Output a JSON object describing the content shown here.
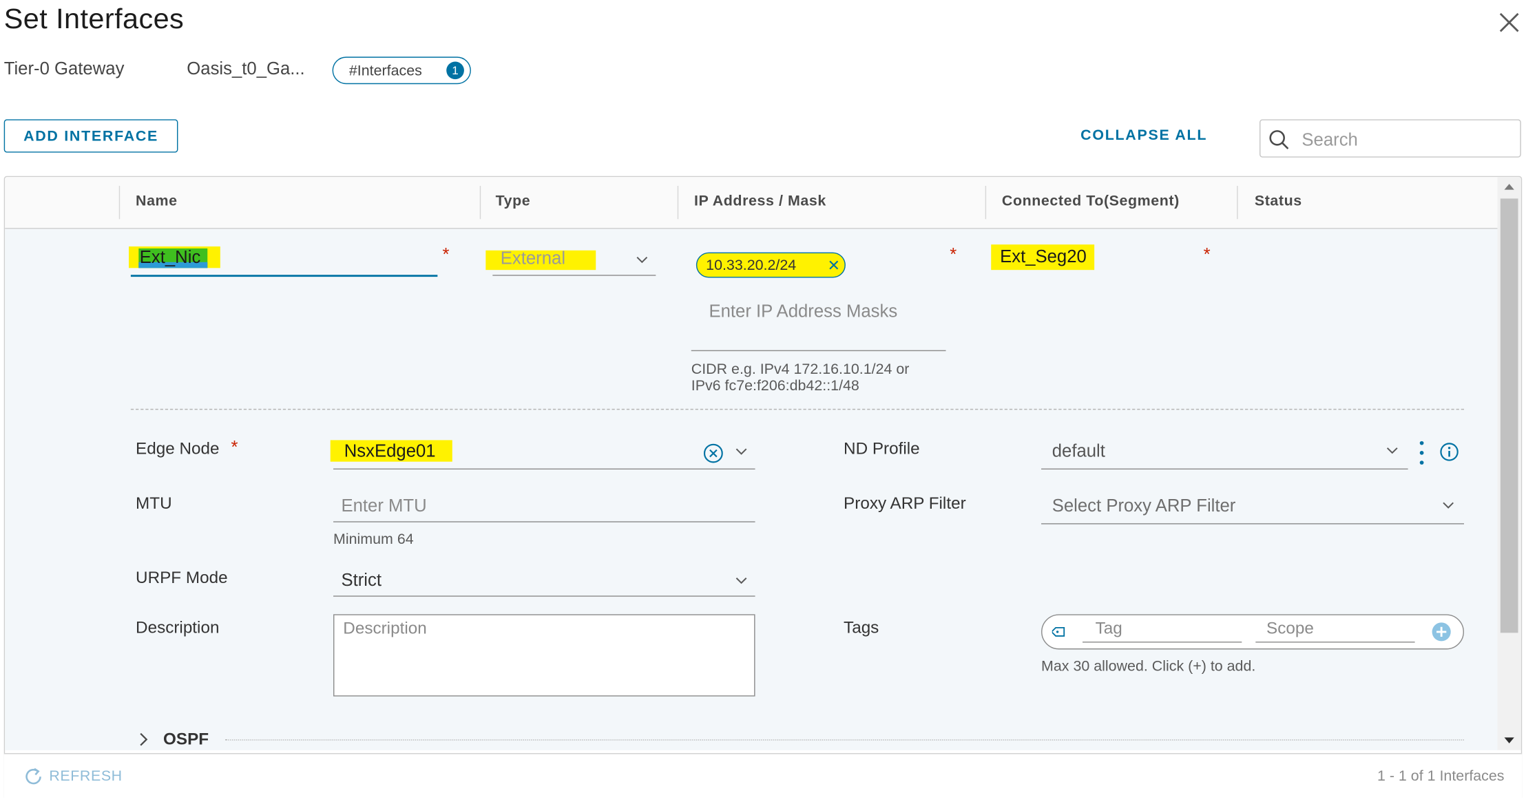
{
  "dialog": {
    "title": "Set Interfaces",
    "breadcrumb_label": "Tier-0 Gateway",
    "breadcrumb_value": "Oasis_t0_Ga...",
    "pill_label": "#Interfaces",
    "pill_count": "1"
  },
  "toolbar": {
    "add_label": "ADD INTERFACE",
    "collapse_label": "COLLAPSE ALL",
    "search_placeholder": "Search"
  },
  "table": {
    "headers": [
      "Name",
      "Type",
      "IP Address / Mask",
      "Connected To(Segment)",
      "Status"
    ]
  },
  "row": {
    "name": "Ext_Nic",
    "type": "External",
    "ip_chip": "10.33.20.2/24",
    "ip_placeholder": "Enter IP Address Masks",
    "ip_help_line1": "CIDR e.g. IPv4 172.16.10.1/24 or",
    "ip_help_line2": "IPv6 fc7e:f206:db42::1/48",
    "segment": "Ext_Seg20",
    "required_mark": "*"
  },
  "details": {
    "edge_node_label": "Edge Node",
    "edge_node_value": "NsxEdge01",
    "mtu_label": "MTU",
    "mtu_placeholder": "Enter MTU",
    "mtu_help": "Minimum 64",
    "urpf_label": "URPF Mode",
    "urpf_value": "Strict",
    "description_label": "Description",
    "description_placeholder": "Description",
    "nd_profile_label": "ND Profile",
    "nd_profile_value": "default",
    "proxy_arp_label": "Proxy ARP Filter",
    "proxy_arp_placeholder": "Select Proxy ARP Filter",
    "tags_label": "Tags",
    "tag_placeholder": "Tag",
    "scope_placeholder": "Scope",
    "tags_help": "Max 30 allowed. Click (+) to add.",
    "ospf_label": "OSPF"
  },
  "footer": {
    "refresh_label": "REFRESH",
    "pagination": "1 - 1 of 1 Interfaces"
  },
  "colors": {
    "accent": "#0072a3",
    "highlight": "#fff200",
    "required": "#c92100",
    "green_highlight": "#3fbf1f",
    "blue_selection": "#2e9bd6"
  }
}
